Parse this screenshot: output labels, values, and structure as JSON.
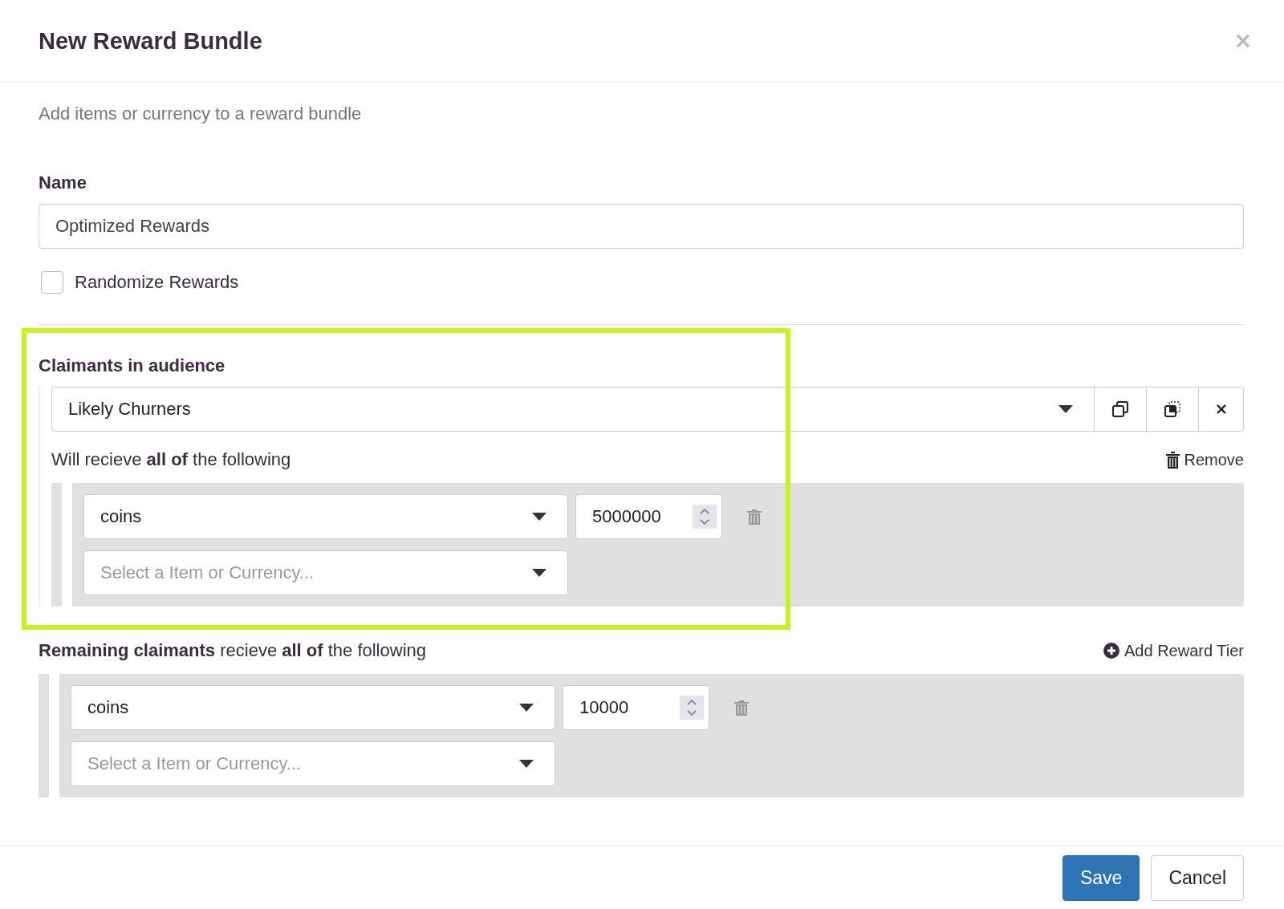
{
  "dialog": {
    "title": "New Reward Bundle"
  },
  "description": "Add items or currency to a reward bundle",
  "name_field": {
    "label": "Name",
    "value": "Optimized Rewards"
  },
  "randomize": {
    "label": "Randomize Rewards",
    "checked": false
  },
  "tiers": [
    {
      "heading": "Claimants in audience",
      "audience": "Likely Churners",
      "highlighted": true,
      "receive_text": "Will recieve **all of** the following",
      "action": "Remove",
      "items": [
        {
          "kind": "item",
          "value": "coins",
          "amount": "5000000"
        },
        {
          "kind": "select",
          "placeholder": "Select a Item or Currency..."
        }
      ]
    }
  ],
  "remaining": {
    "text": "**Remaining claimants** recieve **all of** the following",
    "action": "Add Reward Tier",
    "items": [
      {
        "kind": "item",
        "value": "coins",
        "amount": "10000"
      },
      {
        "kind": "select",
        "placeholder": "Select a Item or Currency..."
      }
    ]
  },
  "buttons": [
    {
      "label": "Save",
      "kind": "primary"
    },
    {
      "label": "Cancel",
      "kind": "default"
    }
  ]
}
